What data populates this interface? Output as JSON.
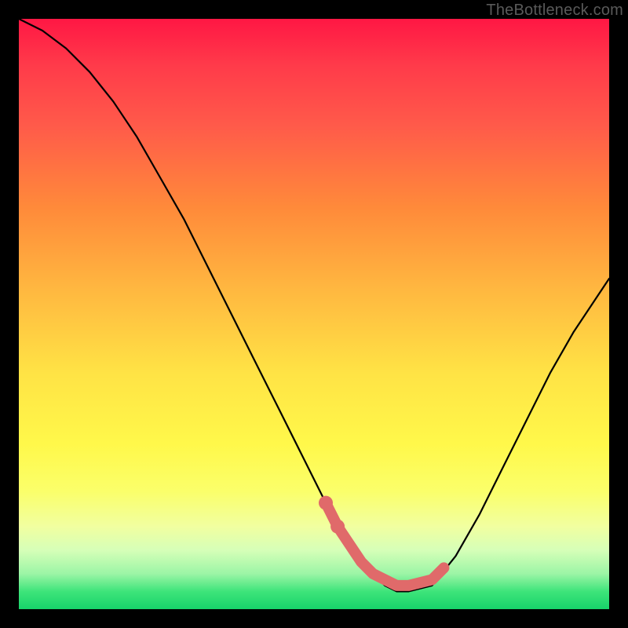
{
  "watermark": "TheBottleneck.com",
  "chart_data": {
    "type": "line",
    "title": "",
    "xlabel": "",
    "ylabel": "",
    "xlim": [
      0,
      100
    ],
    "ylim": [
      0,
      100
    ],
    "series": [
      {
        "name": "bottleneck-curve",
        "x": [
          0,
          4,
          8,
          12,
          16,
          20,
          24,
          28,
          32,
          36,
          40,
          44,
          48,
          52,
          54,
          56,
          58,
          60,
          62,
          64,
          66,
          70,
          74,
          78,
          82,
          86,
          90,
          94,
          98,
          100
        ],
        "values": [
          100,
          98,
          95,
          91,
          86,
          80,
          73,
          66,
          58,
          50,
          42,
          34,
          26,
          18,
          15,
          12,
          9,
          6,
          4,
          3,
          3,
          4,
          9,
          16,
          24,
          32,
          40,
          47,
          53,
          56
        ],
        "color": "#000000"
      },
      {
        "name": "highlight-band",
        "x": [
          52,
          54,
          56,
          58,
          60,
          62,
          64,
          66,
          70,
          72
        ],
        "values": [
          18,
          14,
          11,
          8,
          6,
          5,
          4,
          4,
          5,
          7
        ],
        "color": "#e06a6a"
      }
    ],
    "highlight_dots": [
      {
        "x": 52,
        "y": 18
      },
      {
        "x": 54,
        "y": 14
      }
    ]
  }
}
